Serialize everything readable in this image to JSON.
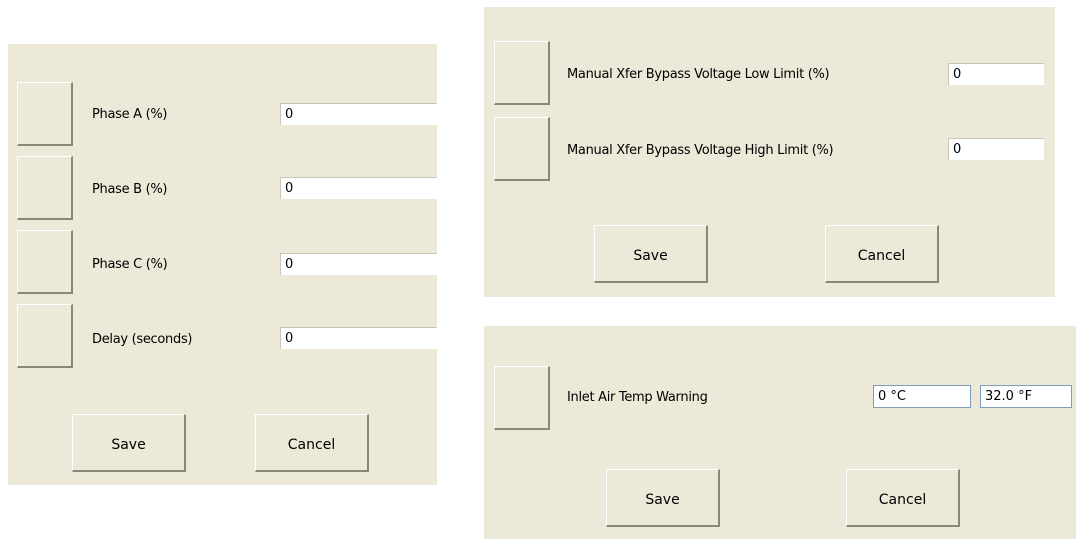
{
  "phase_panel": {
    "rows": [
      {
        "label": "Phase A (%)",
        "value": "0"
      },
      {
        "label": "Phase B (%)",
        "value": "0"
      },
      {
        "label": "Phase C (%)",
        "value": "0"
      },
      {
        "label": "Delay (seconds)",
        "value": "0"
      }
    ],
    "save_label": "Save",
    "cancel_label": "Cancel"
  },
  "bypass_panel": {
    "rows": [
      {
        "label": "Manual Xfer Bypass Voltage Low Limit (%)",
        "value": "0"
      },
      {
        "label": "Manual Xfer Bypass Voltage High Limit (%)",
        "value": "0"
      }
    ],
    "save_label": "Save",
    "cancel_label": "Cancel"
  },
  "temp_panel": {
    "label": "Inlet Air Temp Warning",
    "value_c": "0 °C",
    "value_f": "32.0 °F",
    "save_label": "Save",
    "cancel_label": "Cancel"
  }
}
